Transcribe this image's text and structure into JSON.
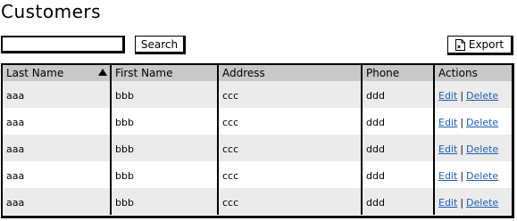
{
  "page": {
    "title": "Customers"
  },
  "search": {
    "value": "",
    "placeholder": "",
    "button_label": "Search"
  },
  "toolbar": {
    "export_label": "Export",
    "export_icon": "document-export-icon"
  },
  "table": {
    "columns": [
      "Last Name",
      "First Name",
      "Address",
      "Phone",
      "Actions"
    ],
    "sort": {
      "column": "Last Name",
      "direction": "ascending"
    },
    "rows": [
      {
        "last_name": "aaa",
        "first_name": "bbb",
        "address": "ccc",
        "phone": "ddd",
        "edit": "Edit",
        "separator": "|",
        "delete": "Delete"
      },
      {
        "last_name": "aaa",
        "first_name": "bbb",
        "address": "ccc",
        "phone": "ddd",
        "edit": "Edit",
        "separator": "|",
        "delete": "Delete"
      },
      {
        "last_name": "aaa",
        "first_name": "bbb",
        "address": "ccc",
        "phone": "ddd",
        "edit": "Edit",
        "separator": "|",
        "delete": "Delete"
      },
      {
        "last_name": "aaa",
        "first_name": "bbb",
        "address": "ccc",
        "phone": "ddd",
        "edit": "Edit",
        "separator": "|",
        "delete": "Delete"
      },
      {
        "last_name": "aaa",
        "first_name": "bbb",
        "address": "ccc",
        "phone": "ddd",
        "edit": "Edit",
        "separator": "|",
        "delete": "Delete"
      }
    ]
  },
  "colors": {
    "header_bg": "#c9c9c9",
    "alt_row_bg": "#ebebeb",
    "link": "#1f5fb0"
  }
}
